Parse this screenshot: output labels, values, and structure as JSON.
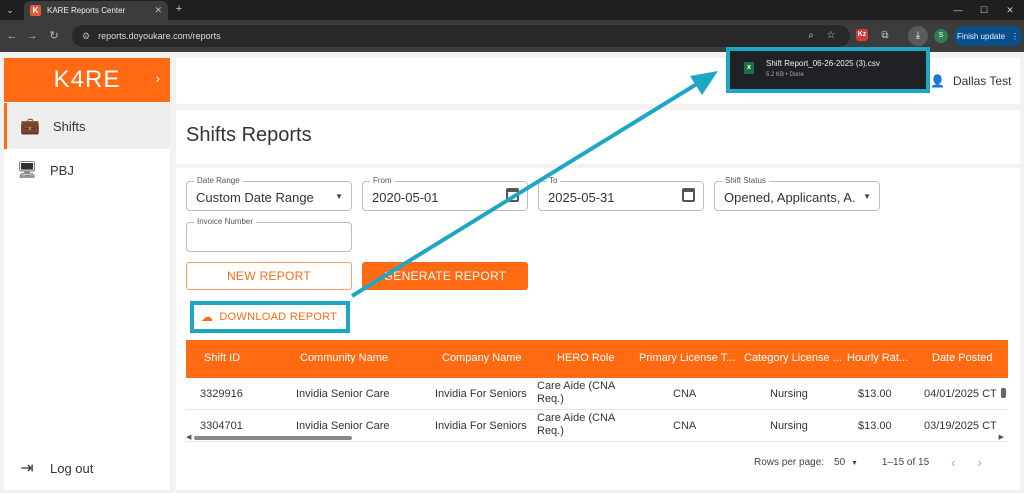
{
  "browser": {
    "tab_title": "KARE Reports Center",
    "tab_favicon": "K",
    "url": "reports.doyoukare.com/reports",
    "finish_update_label": "Finish update",
    "profile_initial": "S",
    "extension_badge": "Kz"
  },
  "download_popup": {
    "file_name": "Shift Report_06-26-2025 (3).csv",
    "status": "5.2 KB • Done",
    "file_icon_letter": "x"
  },
  "sidebar": {
    "logo_text": "K4RE",
    "items": [
      {
        "label": "Shifts",
        "icon": "briefcase-icon",
        "active": true
      },
      {
        "label": "PBJ",
        "icon": "monitor-icon",
        "active": false
      }
    ],
    "logout_label": "Log out"
  },
  "header": {
    "user_name": "Dallas Test"
  },
  "page": {
    "title": "Shifts Reports"
  },
  "filters": {
    "date_range": {
      "label": "Date Range",
      "value": "Custom Date Range"
    },
    "from": {
      "label": "From",
      "value": "2020-05-01"
    },
    "to": {
      "label": "To",
      "value": "2025-05-31"
    },
    "shift_status": {
      "label": "Shift Status",
      "value": "Opened, Applicants, A..."
    },
    "invoice_number": {
      "label": "Invoice Number",
      "value": ""
    }
  },
  "actions": {
    "new_report": "NEW REPORT",
    "generate_report": "GENERATE REPORT",
    "download_report": "DOWNLOAD REPORT"
  },
  "table": {
    "columns": [
      "Shift ID",
      "Community Name",
      "Company Name",
      "HERO Role",
      "Primary License T...",
      "Category License ...",
      "Hourly Rat...",
      "Date Posted"
    ],
    "rows": [
      [
        "3329916",
        "Invidia Senior Care",
        "Invidia For Seniors",
        "Care Aide (CNA Req.)",
        "CNA",
        "Nursing",
        "$13.00",
        "04/01/2025 CT"
      ],
      [
        "3304701",
        "Invidia Senior Care",
        "Invidia For Seniors",
        "Care Aide (CNA Req.)",
        "CNA",
        "Nursing",
        "$13.00",
        "03/19/2025 CT"
      ]
    ]
  },
  "pagination": {
    "rows_per_page_label": "Rows per page:",
    "rows_per_page_value": "50",
    "range": "1–15 of 15"
  },
  "colors": {
    "brand": "#ff6a13",
    "highlight": "#1ea7c5"
  }
}
